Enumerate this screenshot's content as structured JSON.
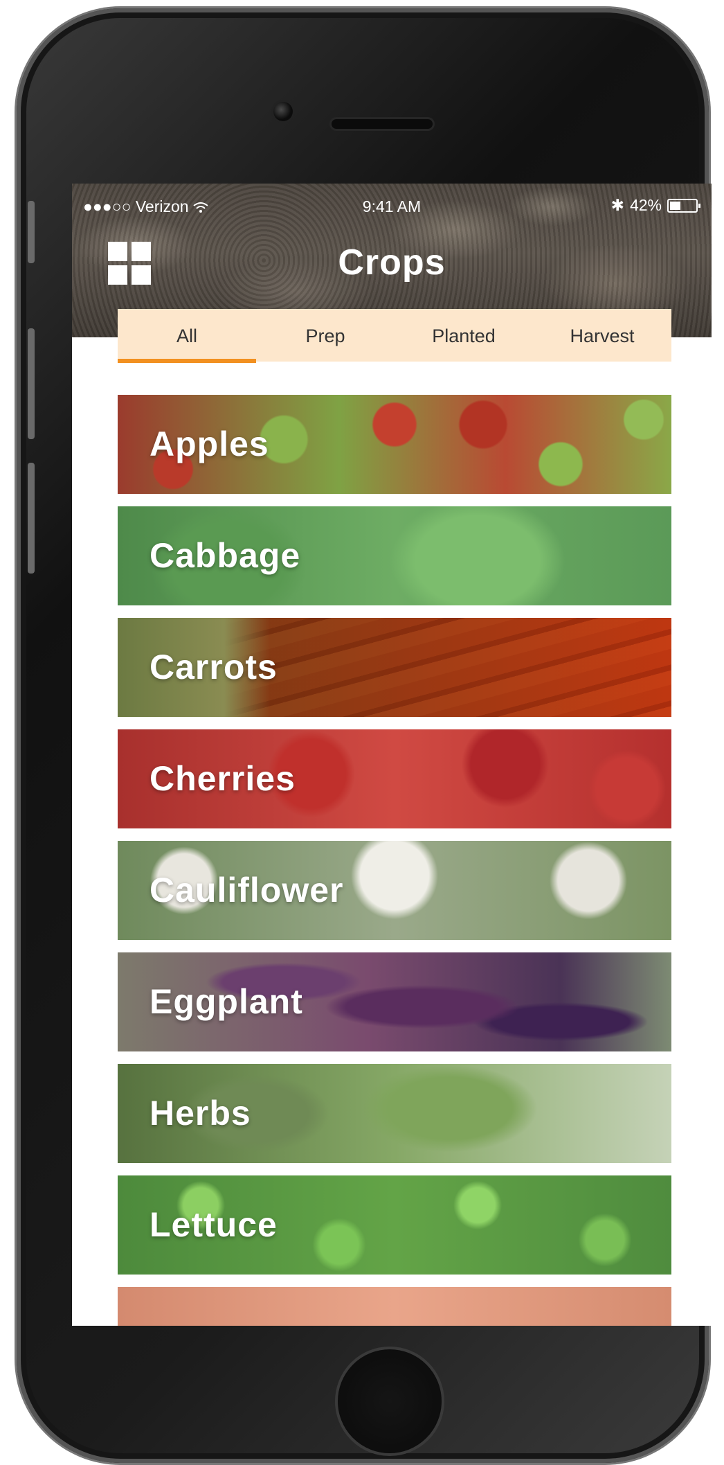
{
  "status_bar": {
    "signal": "●●●○○",
    "carrier": "Verizon",
    "time": "9:41 AM",
    "bluetooth": "✱",
    "battery_percent": "42%",
    "battery_level": 0.42
  },
  "header": {
    "title": "Crops",
    "menu_icon": "grid-icon"
  },
  "tabs": [
    {
      "label": "All",
      "active": true
    },
    {
      "label": "Prep",
      "active": false
    },
    {
      "label": "Planted",
      "active": false
    },
    {
      "label": "Harvest",
      "active": false
    }
  ],
  "crops": [
    {
      "label": "Apples"
    },
    {
      "label": "Cabbage"
    },
    {
      "label": "Carrots"
    },
    {
      "label": "Cherries"
    },
    {
      "label": "Cauliflower"
    },
    {
      "label": "Eggplant"
    },
    {
      "label": "Herbs"
    },
    {
      "label": "Lettuce"
    },
    {
      "label": ""
    }
  ],
  "colors": {
    "accent": "#f29020",
    "tab_bar": "#fde7cc"
  }
}
